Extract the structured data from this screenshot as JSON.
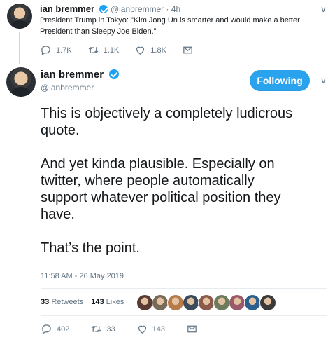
{
  "parent_tweet": {
    "name": "ian bremmer",
    "handle_time": "@ianbremmer · 4h",
    "text_line1": "President Trump in Tokyo: \"Kim Jong Un is smarter and would make a better",
    "text_line2": "President than Sleepy Joe Biden.\"",
    "actions": {
      "reply_count": "1.7K",
      "retweet_count": "1.1K",
      "like_count": "1.8K"
    }
  },
  "main_tweet": {
    "name": "ian bremmer",
    "handle": "@ianbremmer",
    "follow_label": "Following",
    "lines": [
      "This is objectively a completely ludicrous",
      "quote.",
      "And yet kinda plausible. Especially on",
      "twitter, where people automatically",
      "support whatever political position they",
      "have.",
      "That’s the point."
    ],
    "timestamp": "11:58 AM - 26 May 2019",
    "stats": {
      "retweets_count": "33",
      "retweets_label": "Retweets",
      "likes_count": "143",
      "likes_label": "Likes"
    },
    "liker_colors": [
      "#5a3b34",
      "#7a6a5a",
      "#b77b4a",
      "#3a4b5c",
      "#8b5a4a",
      "#6b7b5b",
      "#9a5a6a",
      "#2b5f8f",
      "#3a3a3a"
    ],
    "actions": {
      "reply_count": "402",
      "retweet_count": "33",
      "like_count": "143"
    }
  }
}
